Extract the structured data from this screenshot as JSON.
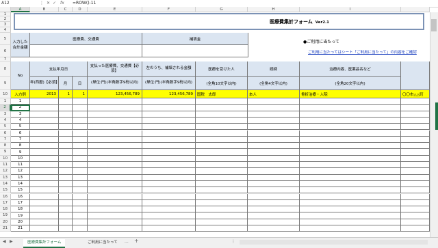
{
  "formula_bar": {
    "name_box": "A12",
    "fx_label": "fx",
    "formula": "=ROW()-11"
  },
  "columns": [
    "A",
    "B",
    "C",
    "D",
    "E",
    "F",
    "G",
    "H",
    "I"
  ],
  "title": {
    "text": "医療費集計フォーム",
    "version": "Ver2.1"
  },
  "row5": {
    "input_total_label": "入力した合計金額",
    "medical_transport": "医療費、交通費",
    "compensation": "補填金"
  },
  "notes": {
    "usage_heading": "●ご利用に当たって",
    "usage_link": "ご利用に当たってはシート「ご利用に当たって」の内容をご確認"
  },
  "headers": {
    "no": "No",
    "pay_date": "支払年月日",
    "year": "年(西暦)【必須】",
    "month": "月",
    "day": "日",
    "paid_amount": "支払った医療費、交通費【必須】",
    "paid_amount_unit": "(単位:円)(半角数字9桁以内)",
    "compensated_amount": "左のうち、補填される金額",
    "compensated_unit": "(単位:円)(半角数字9桁以内)",
    "patient": "医療を受けた人",
    "patient_limit": "(全角10文字以内)",
    "relation": "続柄",
    "relation_limit": "(全角4文字以内)",
    "treatment": "治療内容、医薬品名など",
    "treatment_limit": "(全角20文字以内)"
  },
  "example_row": {
    "label": "入力例",
    "year": "2013",
    "month": "1",
    "day": "1",
    "paid": "123,456,789",
    "compensated": "123,456,789",
    "patient": "国税　太郎",
    "relation": "本人",
    "treatment": "骨折治療・入院",
    "extra": "〇〇市△△町"
  },
  "row_headers": [
    "1",
    "2",
    "3",
    "4",
    "5",
    "6",
    "7",
    "8",
    "9",
    "10",
    "11",
    "12",
    "13",
    "14",
    "15",
    "16",
    "17",
    "18",
    "19",
    "20",
    "21"
  ],
  "data_numbers": [
    "1",
    "2",
    "3",
    "4",
    "5",
    "6",
    "7",
    "8",
    "9",
    "10",
    "11",
    "12",
    "13",
    "14",
    "15",
    "16",
    "17",
    "18",
    "19",
    "20",
    "21"
  ],
  "tabs": [
    "医療費集計フォーム",
    "ご利用に当たって"
  ],
  "tab_more": "...",
  "tab_add": "+"
}
